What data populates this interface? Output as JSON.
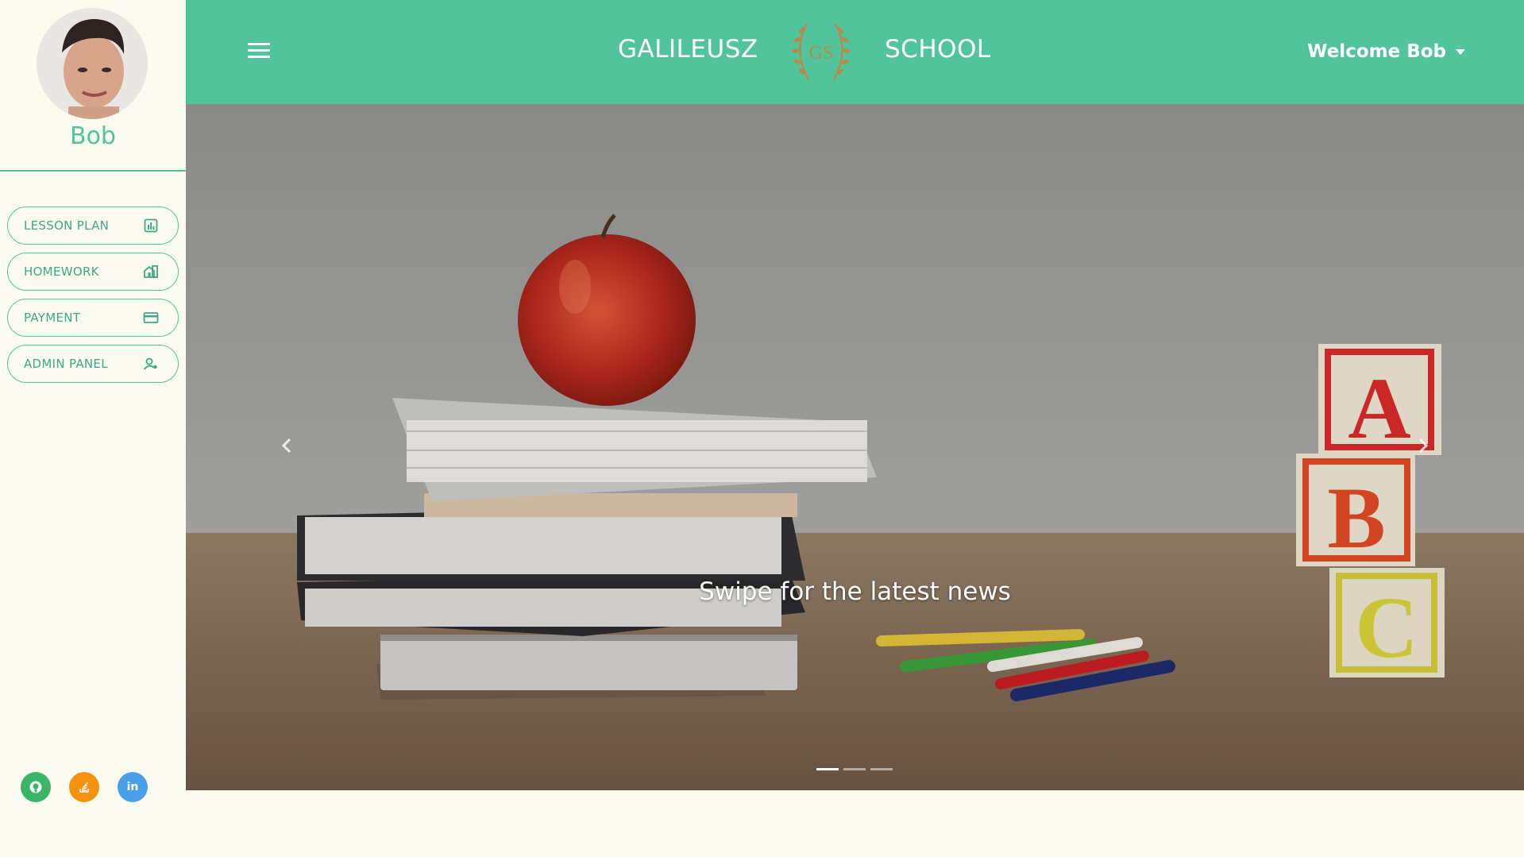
{
  "sidebar": {
    "user_name": "Bob",
    "items": [
      {
        "label": "LESSON PLAN",
        "icon": "chart-icon"
      },
      {
        "label": "HOMEWORK",
        "icon": "house-icon"
      },
      {
        "label": "PAYMENT",
        "icon": "credit-card-icon"
      },
      {
        "label": "ADMIN PANEL",
        "icon": "admin-user-icon"
      }
    ],
    "social": [
      {
        "name": "github",
        "color": "#3bb56a"
      },
      {
        "name": "stackoverflow",
        "color": "#f6900f"
      },
      {
        "name": "linkedin",
        "color": "#4aa0e6",
        "text": "in"
      }
    ]
  },
  "header": {
    "brand_left": "GALILEUSZ",
    "logo_text": "GS",
    "brand_right": "SCHOOL",
    "welcome": "Welcome Bob"
  },
  "carousel": {
    "caption": "Swipe for the latest news",
    "slide_count": 3,
    "active_slide": 1,
    "block_letters": [
      "A",
      "B",
      "C"
    ]
  },
  "colors": {
    "primary": "#52c49c",
    "background": "#fbfbf0"
  }
}
